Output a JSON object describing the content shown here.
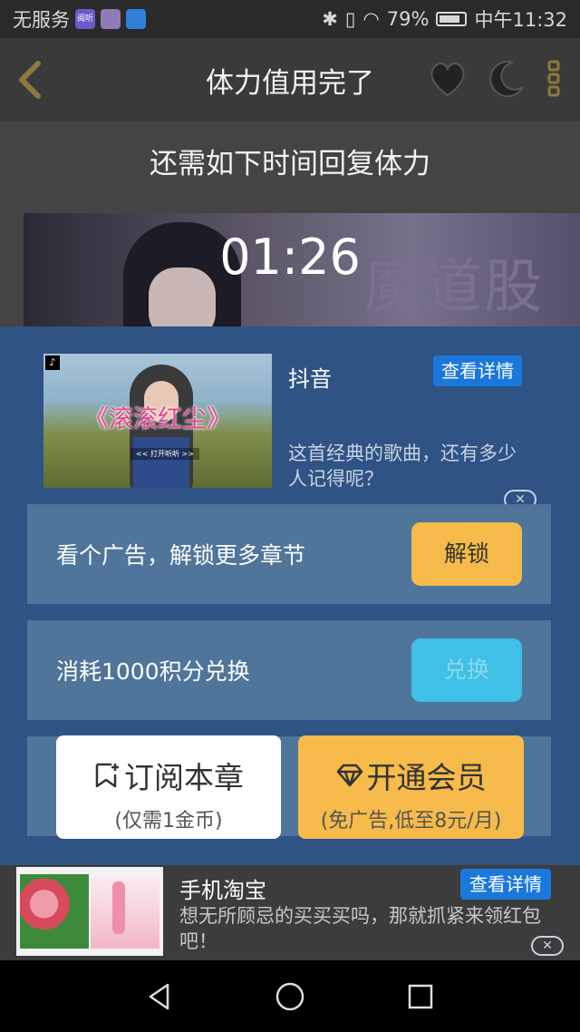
{
  "status_bar": {
    "carrier": "无服务",
    "app_badge": "阅听",
    "battery": "79%",
    "time": "中午11:32"
  },
  "header": {
    "title": "体力值用完了"
  },
  "subtitle": "还需如下时间回复体力",
  "banner": {
    "calligraphy": "魔道股"
  },
  "timer": "01:26",
  "ad_top": {
    "source": "抖音",
    "detail_button": "查看详情",
    "image_title": "《滚滚红尘》",
    "image_caption": "<< 打开听听 >>",
    "description": "这首经典的歌曲，还有多少人记得呢？",
    "close": "✕"
  },
  "option_watch_ad": {
    "label": "看个广告，解锁更多章节",
    "button": "解锁"
  },
  "option_points": {
    "label": "消耗1000积分兑换",
    "button": "兑换"
  },
  "subscribe_chapter": {
    "title": "订阅本章",
    "subtitle": "(仅需1金币)"
  },
  "membership": {
    "title": "开通会员",
    "subtitle": "(免广告,低至8元/月)"
  },
  "ad_bottom": {
    "source": "手机淘宝",
    "detail_button": "查看详情",
    "description": "想无所顾忌的买买买吗，那就抓紧来领红包吧！",
    "close": "✕"
  },
  "colors": {
    "sheet_bg": "#2e5384",
    "row_bg": "#4f759b",
    "accent_gold": "#f6bb4a",
    "accent_cyan": "#3fc0e6",
    "detail_blue": "#1a78dc"
  }
}
